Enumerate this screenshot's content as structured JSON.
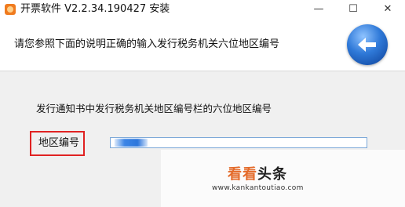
{
  "window": {
    "title": "开票软件 V2.2.34.190427 安装",
    "buttons": {
      "minimize": "—",
      "maximize": "☐",
      "close": "✕"
    }
  },
  "header": {
    "instruction": "请您参照下面的说明正确的输入发行税务机关六位地区编号",
    "back_icon": "back-arrow-icon"
  },
  "form": {
    "description": "发行通知书中发行税务机关地区编号栏的六位地区编号",
    "region_code_label": "地区编号",
    "region_code_value": ""
  },
  "watermark": {
    "text_a": "看看",
    "text_b": "头条",
    "url": "www.kankantoutiao.com"
  },
  "colors": {
    "app_icon": "#f07b1f",
    "highlight_border": "#e02222",
    "back_button": "#2f79d8",
    "watermark_accent": "#e46b2b"
  }
}
